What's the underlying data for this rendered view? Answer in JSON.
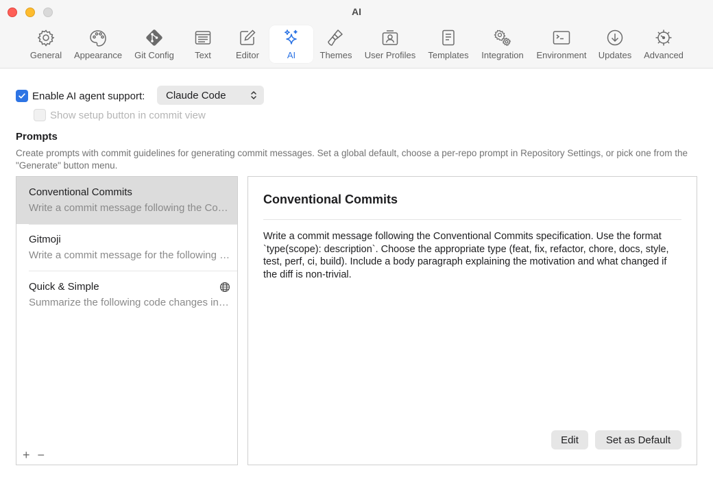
{
  "window": {
    "title": "AI"
  },
  "toolbar": {
    "tabs": [
      {
        "label": "General",
        "icon": "gear-icon"
      },
      {
        "label": "Appearance",
        "icon": "palette-icon"
      },
      {
        "label": "Git Config",
        "icon": "git-icon"
      },
      {
        "label": "Text",
        "icon": "text-window-icon"
      },
      {
        "label": "Editor",
        "icon": "edit-icon"
      },
      {
        "label": "AI",
        "icon": "sparkles-icon",
        "active": true
      },
      {
        "label": "Themes",
        "icon": "paintbrush-icon"
      },
      {
        "label": "User Profiles",
        "icon": "user-profile-icon"
      },
      {
        "label": "Templates",
        "icon": "document-icon"
      },
      {
        "label": "Integration",
        "icon": "gears-icon"
      },
      {
        "label": "Environment",
        "icon": "terminal-icon"
      },
      {
        "label": "Updates",
        "icon": "download-circle-icon"
      },
      {
        "label": "Advanced",
        "icon": "advanced-gear-icon"
      }
    ]
  },
  "settings": {
    "enable_label": "Enable AI agent support:",
    "enable_checked": true,
    "agent_selected": "Claude Code",
    "setup_label": "Show setup button in commit view",
    "setup_checked": false
  },
  "prompts": {
    "title": "Prompts",
    "description": "Create prompts with commit guidelines for generating commit messages. Set a global default, choose a per-repo prompt in Repository Settings, or pick one from the \"Generate\" button menu.",
    "items": [
      {
        "name": "Conventional Commits",
        "summary": "Write a commit message following the Conventional Commits specification.",
        "selected": true
      },
      {
        "name": "Gitmoji",
        "summary": "Write a commit message for the following changes using Gitmoji."
      },
      {
        "name": "Quick & Simple",
        "summary": "Summarize the following code changes in a single line.",
        "global": true
      }
    ],
    "add_label": "+",
    "remove_label": "−"
  },
  "detail": {
    "title": "Conventional Commits",
    "body": "Write a commit message following the Conventional Commits specification. Use the format `type(scope): description`. Choose the appropriate type (feat, fix, refactor, chore, docs, style, test, perf, ci, build). Include a body paragraph explaining the motivation and what changed if the diff is non-trivial.",
    "edit_label": "Edit",
    "default_label": "Set as Default"
  },
  "colors": {
    "accent": "#2d74e4",
    "selection": "#dcdcdc"
  }
}
